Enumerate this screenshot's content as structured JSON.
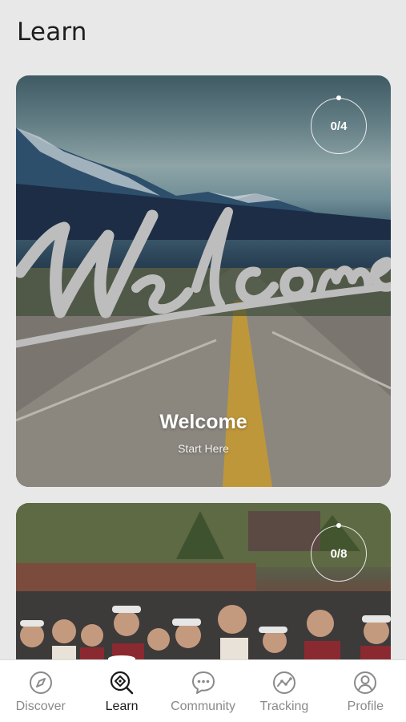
{
  "header": {
    "title": "Learn"
  },
  "cards": [
    {
      "title": "Welcome",
      "subtitle": "Start Here",
      "progress": "0/4",
      "image_script_text": "Welcome"
    },
    {
      "title": "",
      "subtitle": "",
      "progress": "0/8"
    }
  ],
  "nav": {
    "items": [
      {
        "label": "Discover",
        "icon": "compass-icon"
      },
      {
        "label": "Learn",
        "icon": "learn-search-icon",
        "active": true
      },
      {
        "label": "Community",
        "icon": "chat-bubble-icon"
      },
      {
        "label": "Tracking",
        "icon": "tracking-chart-icon"
      },
      {
        "label": "Profile",
        "icon": "profile-icon"
      }
    ]
  },
  "colors": {
    "background": "#e8e8e8",
    "active": "#1a1a1a",
    "inactive": "#8a8a8a"
  }
}
